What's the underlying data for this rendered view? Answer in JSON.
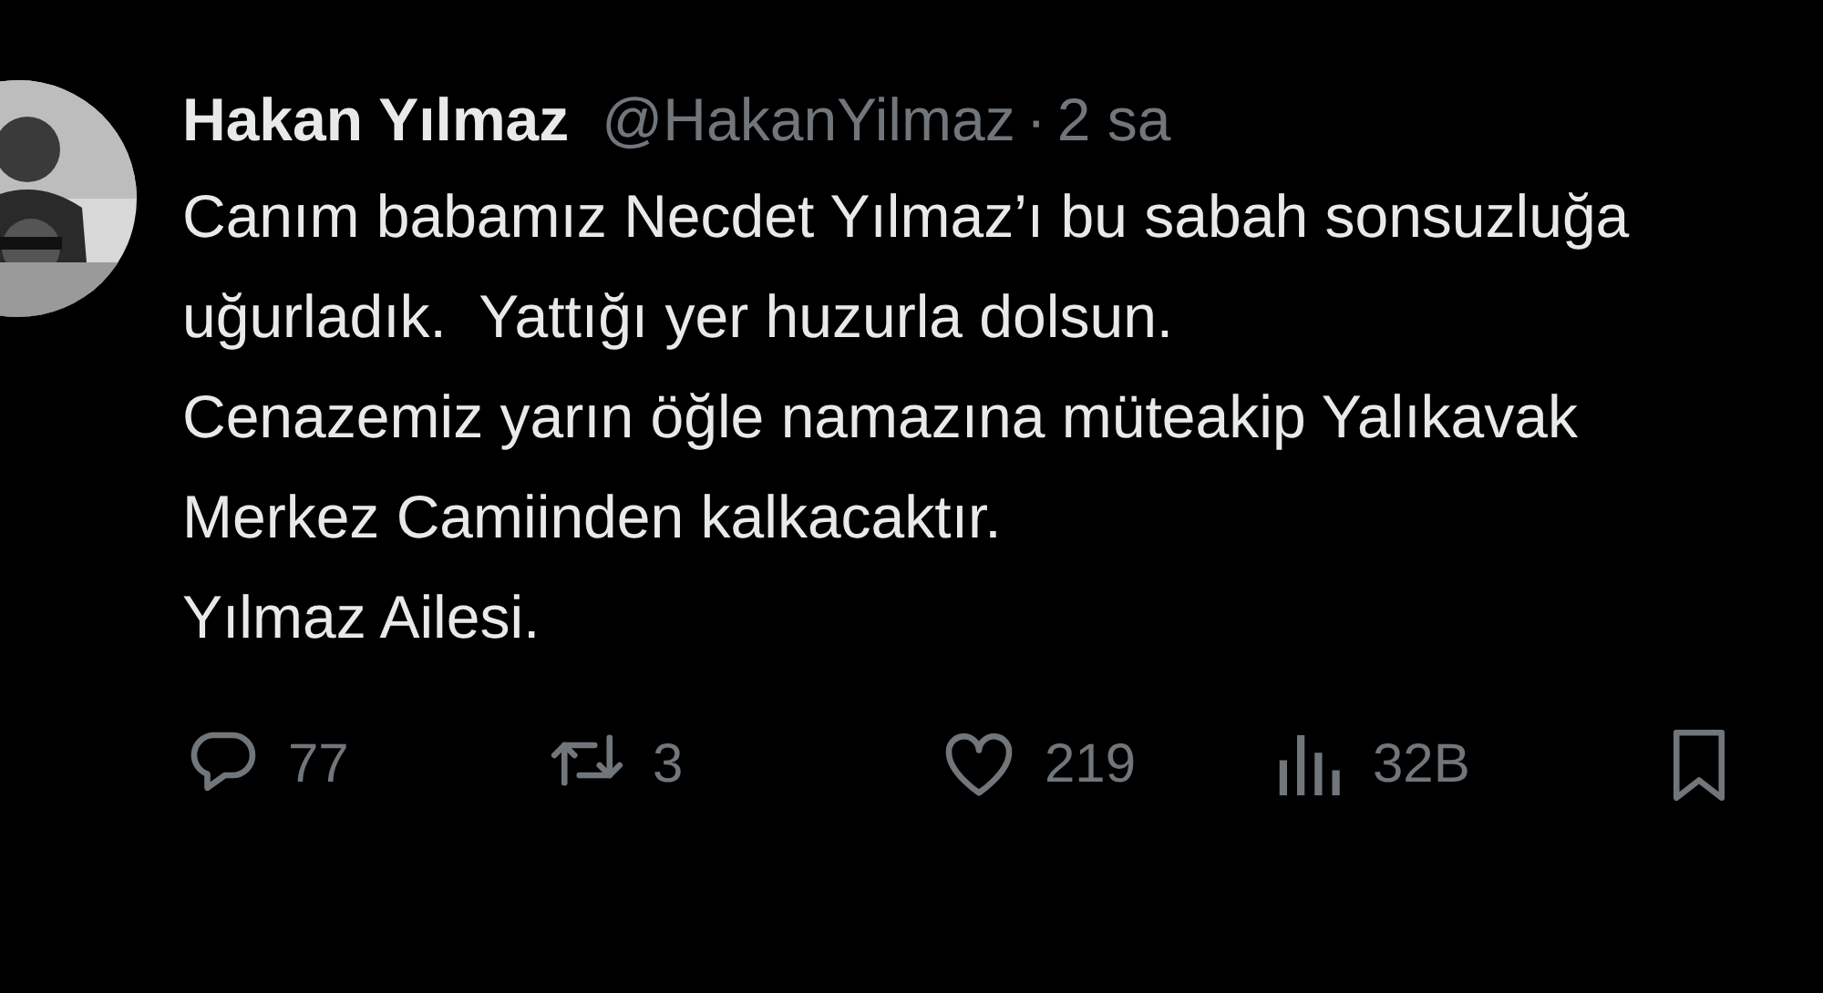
{
  "tweet": {
    "author": {
      "name": "Hakan Yılmaz",
      "handle": "@HakanYilmaz",
      "separator": "·",
      "time": "2 sa"
    },
    "paragraphs": [
      "Canım babamız Necdet Yılmaz’ı bu sabah sonsuzluğa uğurladık.  Yattığı yer huzurla dolsun.",
      "Cenazemiz yarın öğle namazına müteakip Yalıkavak Merkez Camiinden kalkacaktır.",
      "Yılmaz Ailesi."
    ],
    "actions": [
      {
        "kind": "reply",
        "count": "77"
      },
      {
        "kind": "repost",
        "count": "3"
      },
      {
        "kind": "like",
        "count": "219"
      },
      {
        "kind": "views",
        "count": "32B"
      },
      {
        "kind": "bookmark"
      }
    ]
  }
}
